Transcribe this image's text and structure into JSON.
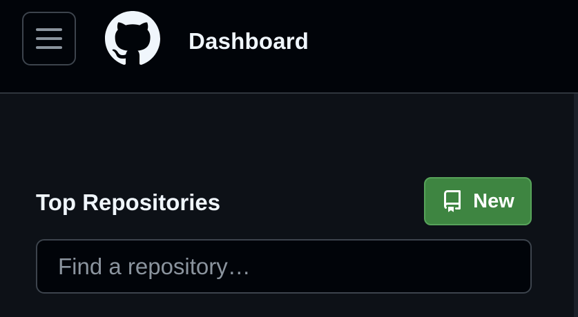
{
  "header": {
    "menu_icon": "hamburger-menu-icon",
    "logo_icon": "github-logo-icon",
    "title": "Dashboard"
  },
  "repositories": {
    "title": "Top Repositories",
    "new_button": {
      "label": "New",
      "icon": "repo-icon"
    },
    "search": {
      "placeholder": "Find a repository…",
      "value": ""
    }
  },
  "colors": {
    "header_background": "#010409",
    "page_background": "#0d1117",
    "primary_button": "#3e8541",
    "text": "#f0f6fc",
    "placeholder": "#8b949e"
  }
}
